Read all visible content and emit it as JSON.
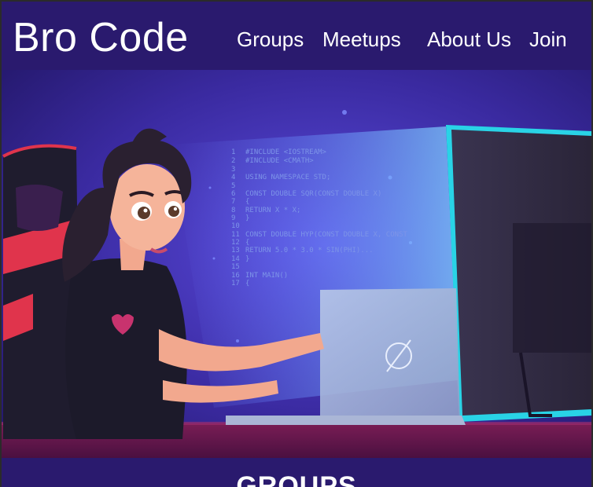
{
  "brand": {
    "name": "Bro Code"
  },
  "nav": {
    "items": [
      {
        "label": "Groups"
      },
      {
        "label": "Meetups"
      },
      {
        "label": "About Us"
      },
      {
        "label": "Join"
      }
    ]
  },
  "hero": {
    "code_lines": [
      {
        "num": "1",
        "text": "#INCLUDE <IOSTREAM>"
      },
      {
        "num": "2",
        "text": "#INCLUDE <CMATH>"
      },
      {
        "num": "3",
        "text": ""
      },
      {
        "num": "4",
        "text": "USING NAMESPACE STD;"
      },
      {
        "num": "5",
        "text": ""
      },
      {
        "num": "6",
        "text": "CONST DOUBLE SQR(CONST DOUBLE X)"
      },
      {
        "num": "7",
        "text": "{"
      },
      {
        "num": "8",
        "text": "    RETURN X * X;"
      },
      {
        "num": "9",
        "text": "}"
      },
      {
        "num": "10",
        "text": ""
      },
      {
        "num": "11",
        "text": "CONST DOUBLE HYP(CONST DOUBLE X, CONST"
      },
      {
        "num": "12",
        "text": "{"
      },
      {
        "num": "13",
        "text": "    RETURN 5.0 * 3.0 * SIN(PHI)..."
      },
      {
        "num": "14",
        "text": "}"
      },
      {
        "num": "15",
        "text": ""
      },
      {
        "num": "16",
        "text": "INT MAIN()"
      },
      {
        "num": "17",
        "text": "{"
      }
    ]
  },
  "section": {
    "title": "GROUPS"
  },
  "colors": {
    "header_bg": "#2a1a6e",
    "hero_bg": "#3a2aa0",
    "desk": "#6b1a4a",
    "accent": "#29d3e6"
  }
}
